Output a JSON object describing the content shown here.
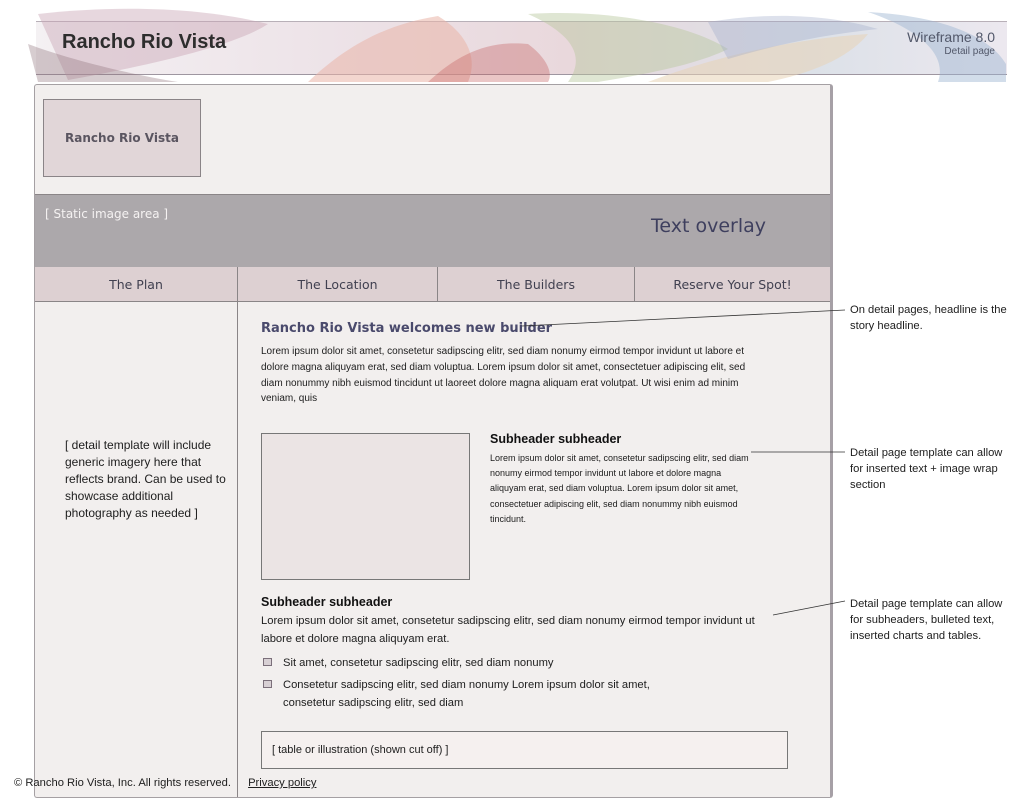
{
  "banner": {
    "title": "Rancho Rio Vista",
    "version": "Wireframe 8.0",
    "page_name": "Detail page"
  },
  "page": {
    "logo_text": "Rancho Rio Vista",
    "hero": {
      "label": "[ Static image area ]",
      "overlay": "Text overlay"
    },
    "nav": [
      {
        "label": "The Plan"
      },
      {
        "label": "The Location"
      },
      {
        "label": "The Builders"
      },
      {
        "label": "Reserve Your Spot!"
      }
    ],
    "sidebar_note": "[ detail template will include generic imagery here that reflects brand. Can be used to showcase additional photography as needed ]",
    "headline": "Rancho Rio Vista welcomes new builder",
    "body": "Lorem ipsum dolor sit amet, consetetur sadipscing elitr, sed diam nonumy eirmod tempor invidunt ut labore et dolore magna aliquyam erat, sed diam voluptua. Lorem ipsum dolor sit amet, consectetuer adipiscing elit, sed diam nonummy nibh euismod tincidunt ut laoreet dolore magna aliquam erat volutpat. Ut wisi enim ad minim veniam, quis",
    "subheader1": {
      "title": "Subheader subheader",
      "body": "Lorem ipsum dolor sit amet, consetetur sadipscing elitr, sed diam nonumy eirmod tempor invidunt ut labore et dolore magna aliquyam erat, sed diam voluptua. Lorem ipsum dolor sit amet, consectetuer adipiscing elit, sed diam nonummy nibh euismod tincidunt."
    },
    "subheader2": {
      "title": "Subheader subheader",
      "body": "Lorem ipsum dolor sit amet, consetetur sadipscing elitr, sed diam nonumy eirmod tempor invidunt ut labore et dolore magna aliquyam erat."
    },
    "bullets": [
      "Sit amet, consetetur sadipscing elitr, sed diam nonumy",
      "Consetetur sadipscing elitr, sed diam nonumy Lorem ipsum dolor sit amet, consetetur sadipscing elitr, sed diam"
    ],
    "table_placeholder": "[ table or illustration (shown cut off) ]"
  },
  "footer": {
    "copyright": "© Rancho Rio Vista, Inc. All rights reserved.",
    "privacy_link": "Privacy policy"
  },
  "annotations": [
    "On detail pages, headline is the story headline.",
    "Detail page template can allow for inserted  text + image wrap section",
    "Detail page template can allow for subheaders, bulleted text, inserted charts and tables."
  ],
  "colors": {
    "frame_bg": "#f2efee",
    "hero_bg": "#aca8ab",
    "nav_bg": "#ddd0d2",
    "headline": "#4a4a6c"
  }
}
